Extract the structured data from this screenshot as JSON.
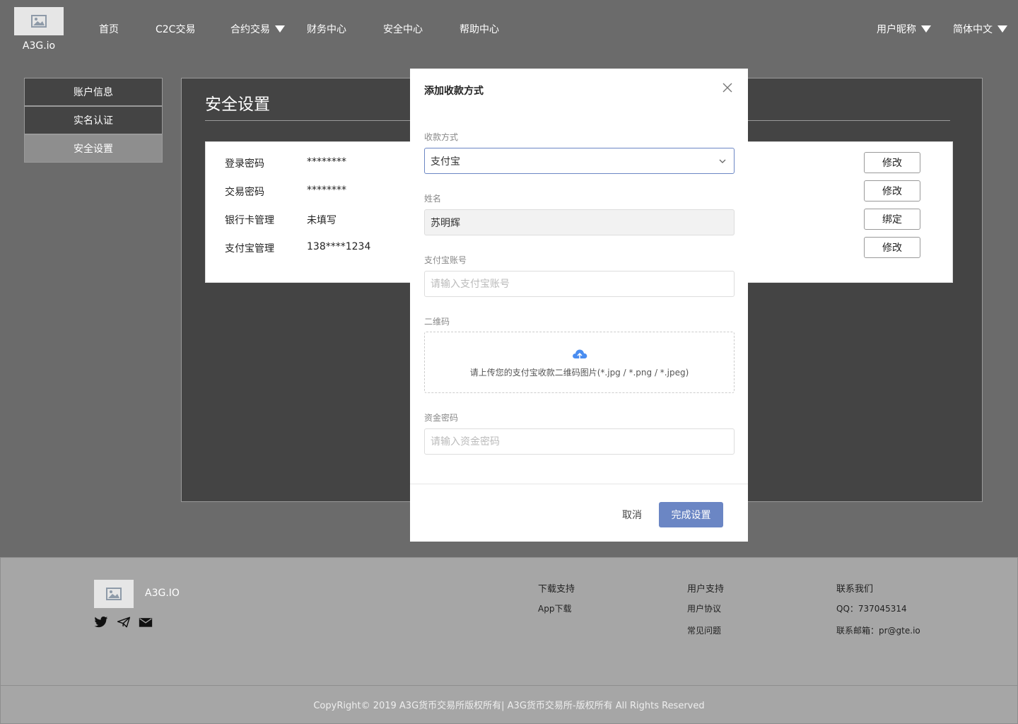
{
  "header": {
    "brand": "A3G.io",
    "logo_icon": "image-placeholder-icon",
    "nav": [
      {
        "label": "首页"
      },
      {
        "label": "C2C交易"
      },
      {
        "label": "合约交易"
      },
      {
        "label": "财务中心"
      },
      {
        "label": "安全中心"
      },
      {
        "label": "帮助中心"
      }
    ],
    "user_menu": "用户昵称",
    "language": "简体中文"
  },
  "sidebar": {
    "items": [
      {
        "label": "账户信息"
      },
      {
        "label": "实名认证"
      },
      {
        "label": "安全设置",
        "active": true
      }
    ]
  },
  "main": {
    "title": "安全设置",
    "rows": [
      {
        "label": "登录密码",
        "value": "********",
        "action": "修改"
      },
      {
        "label": "交易密码",
        "value": "********",
        "action": "修改"
      },
      {
        "label": "银行卡管理",
        "value": "未填写",
        "action": "绑定"
      },
      {
        "label": "支付宝管理",
        "value": "138****1234",
        "action": "修改"
      }
    ]
  },
  "modal": {
    "title": "添加收款方式",
    "method_label": "收款方式",
    "method_value": "支付宝",
    "name_label": "姓名",
    "name_value": "苏明辉",
    "account_label": "支付宝账号",
    "account_placeholder": "请输入支付宝账号",
    "qr_label": "二维码",
    "qr_hint": "请上传您的支付宝收款二维码图片(*.jpg / *.png / *.jpeg)",
    "fund_pw_label": "资金密码",
    "fund_pw_placeholder": "请输入资金密码",
    "cancel": "取消",
    "confirm": "完成设置",
    "accent_color": "#6b86c4"
  },
  "footer": {
    "brand": "A3G.IO",
    "social_icons": [
      "twitter-icon",
      "telegram-icon",
      "mail-icon"
    ],
    "columns": [
      {
        "heading": "下载支持",
        "links": [
          "App下载"
        ]
      },
      {
        "heading": "用户支持",
        "links": [
          "用户协议",
          "常见问题"
        ]
      },
      {
        "heading": "联系我们",
        "links": [
          "QQ：737045314",
          "联系邮箱：pr@gte.io"
        ]
      }
    ],
    "copyright": "CopyRight© 2019 A3G货币交易所版权所有| A3G货币交易所-版权所有 All Rights Reserved"
  }
}
